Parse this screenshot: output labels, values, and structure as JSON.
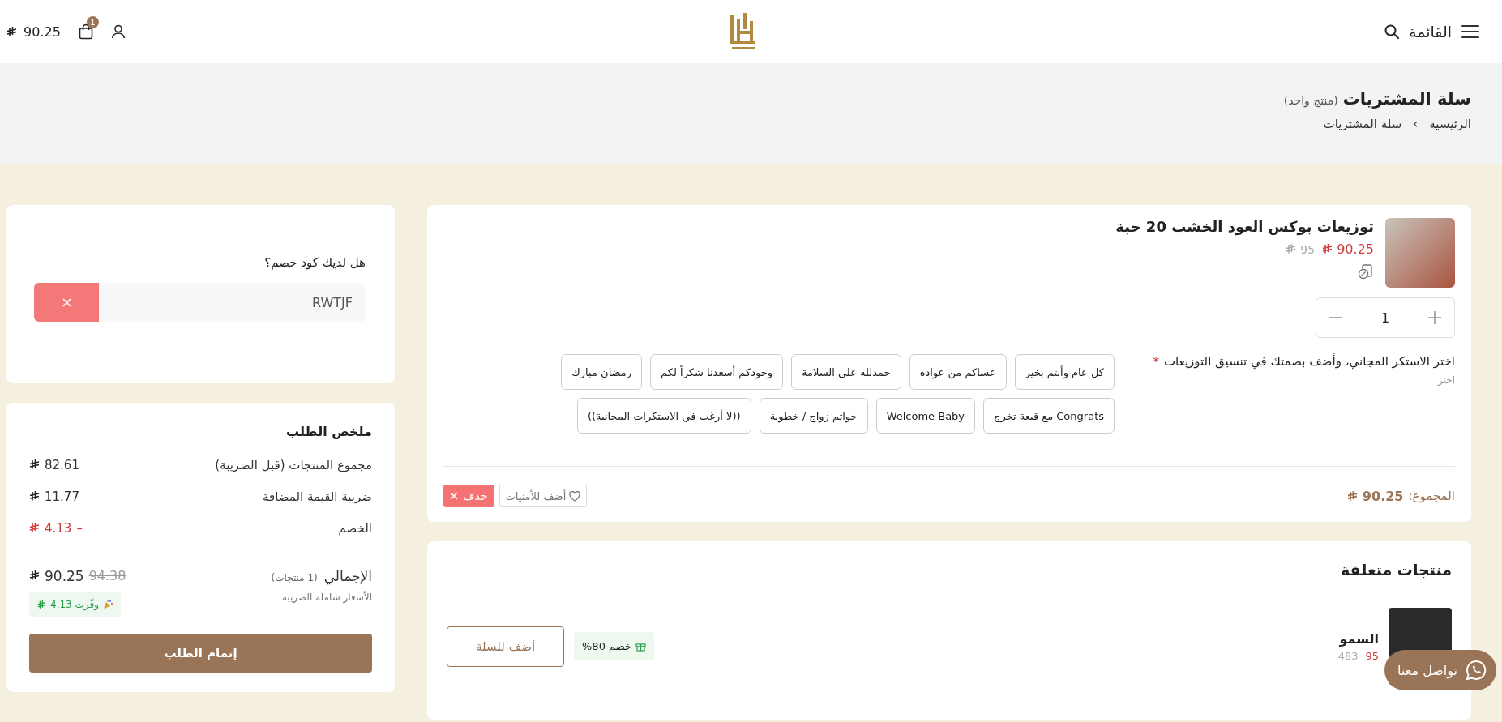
{
  "header": {
    "menu_label": "القائمة",
    "cart_count": "1",
    "cart_total": "90.25"
  },
  "page_header": {
    "title": "سلة المشتريات",
    "subtitle": "(منتج واحد)",
    "breadcrumb_separator": "›",
    "breadcrumbs": [
      {
        "label": "الرئيسية"
      },
      {
        "label": "سلة المشتريات"
      }
    ]
  },
  "cart_item": {
    "name": "توزيعات بوكس العود الخشب 20 حبة",
    "old_price": "95",
    "price": "90.25",
    "quantity": "1",
    "option": {
      "label": "اختر الاستكر المجاني، وأضف بصمتك في تنسيق التوزيعات",
      "required_mark": "*",
      "hint": "اختر",
      "choices": [
        {
          "label": "كل عام وأنتم بخير",
          "selected": false
        },
        {
          "label": "عساكم من عواده",
          "selected": false
        },
        {
          "label": "حمدلله على السلامة",
          "selected": false
        },
        {
          "label": "وجودكم أسعدنا شكراً لكم",
          "selected": false
        },
        {
          "label": "رمضان مبارك",
          "selected": false
        },
        {
          "label": "Congrats مع قبعة تخرج",
          "selected": false
        },
        {
          "label": "Welcome Baby",
          "selected": false
        },
        {
          "label": "خواتم زواج / خطوبة",
          "selected": false
        },
        {
          "label": "((لا أرغب في الاستكرات المجانية))",
          "selected": false
        }
      ]
    },
    "total_label": "المجموع:",
    "total_value": "90.25",
    "wishlist_label": "أضف للأمنيات",
    "delete_label": "حذف"
  },
  "coupon": {
    "label": "هل لديك كود خصم؟",
    "value": "RWTJF"
  },
  "summary": {
    "title": "ملخص الطلب",
    "rows": [
      {
        "label": "مجموع المنتجات (قبل الضريبة)",
        "value": "82.61",
        "kind": "normal"
      },
      {
        "label": "ضريبة القيمة المضافة",
        "value": "11.77",
        "kind": "normal"
      },
      {
        "label": "الخصم",
        "value": "4.13",
        "sign": "–",
        "kind": "discount"
      }
    ],
    "total_label": "الإجمالي",
    "total_count": "(1 منتجات)",
    "old_total": "94.38",
    "total": "90.25",
    "tax_note": "الأسعار شاملة الضريبة",
    "savings_label": "وفّرت",
    "savings_value": "4.13",
    "checkout_label": "إتمام الطلب"
  },
  "related": {
    "title": "منتجات متعلقة",
    "products": [
      {
        "name": "السمو",
        "price": "95",
        "old_price": "483",
        "discount_badge": "خصم 80%",
        "add_label": "أضف للسلة"
      }
    ]
  },
  "contact_button": "تواصل معنا"
}
